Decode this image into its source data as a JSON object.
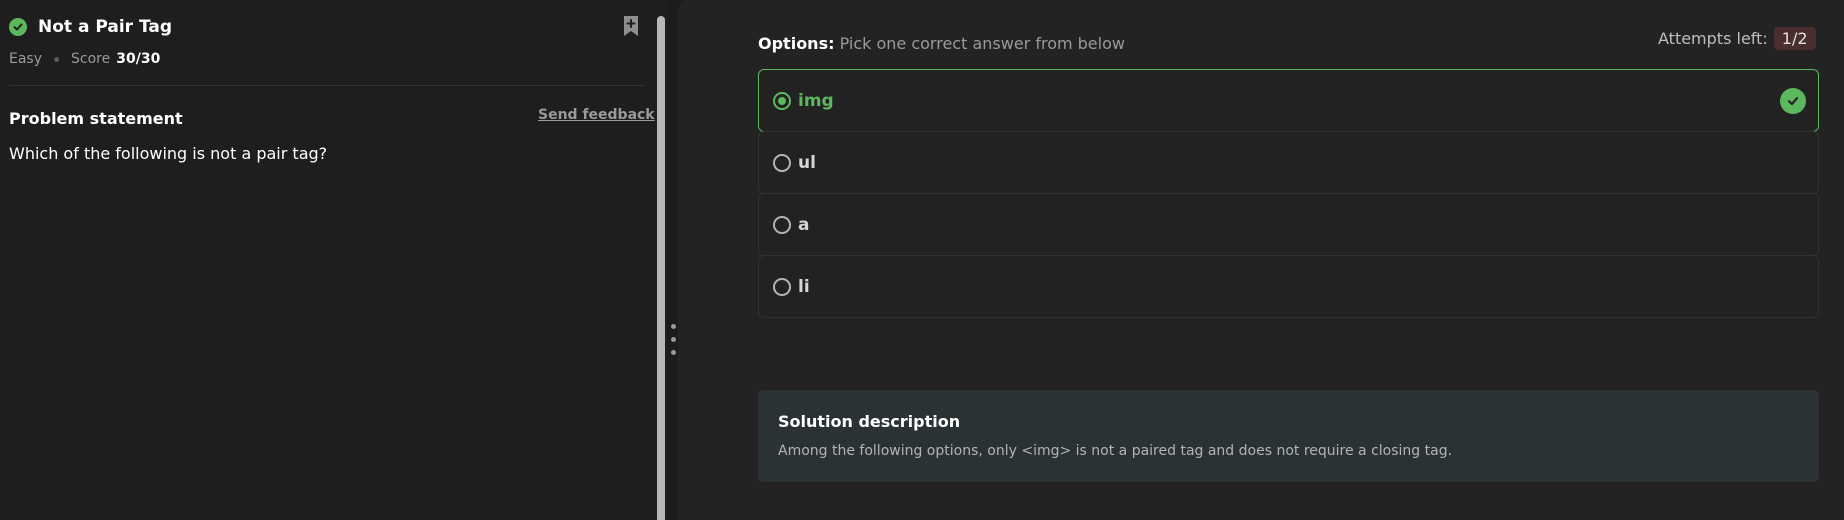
{
  "problem": {
    "title": "Not a Pair Tag",
    "difficulty": "Easy",
    "score_label": "Score",
    "score_value": "30/30",
    "statement_heading": "Problem statement",
    "feedback_link": "Send feedback",
    "question": "Which of the following is not a pair tag?"
  },
  "answer": {
    "options_label": "Options:",
    "options_hint": "Pick one correct answer from below",
    "attempts_label": "Attempts left:",
    "attempts_value": "1/2",
    "options": [
      {
        "label": "img",
        "selected": true,
        "correct": true
      },
      {
        "label": "ul",
        "selected": false,
        "correct": false
      },
      {
        "label": "a",
        "selected": false,
        "correct": false
      },
      {
        "label": "li",
        "selected": false,
        "correct": false
      }
    ]
  },
  "solution": {
    "title": "Solution description",
    "text": "Among the following options, only <img> is not a paired tag and does not require a closing tag."
  },
  "colors": {
    "success": "#5cb85c",
    "panel_bg": "#1e1e1e",
    "content_bg": "#232323",
    "solution_bg": "#2a3234",
    "attempts_badge_bg": "#4a2e2e"
  },
  "icons": {
    "status": "check-circle-icon",
    "bookmark": "bookmark-plus-icon",
    "splitter": "drag-handle-icon",
    "correct": "check-circle-icon"
  }
}
